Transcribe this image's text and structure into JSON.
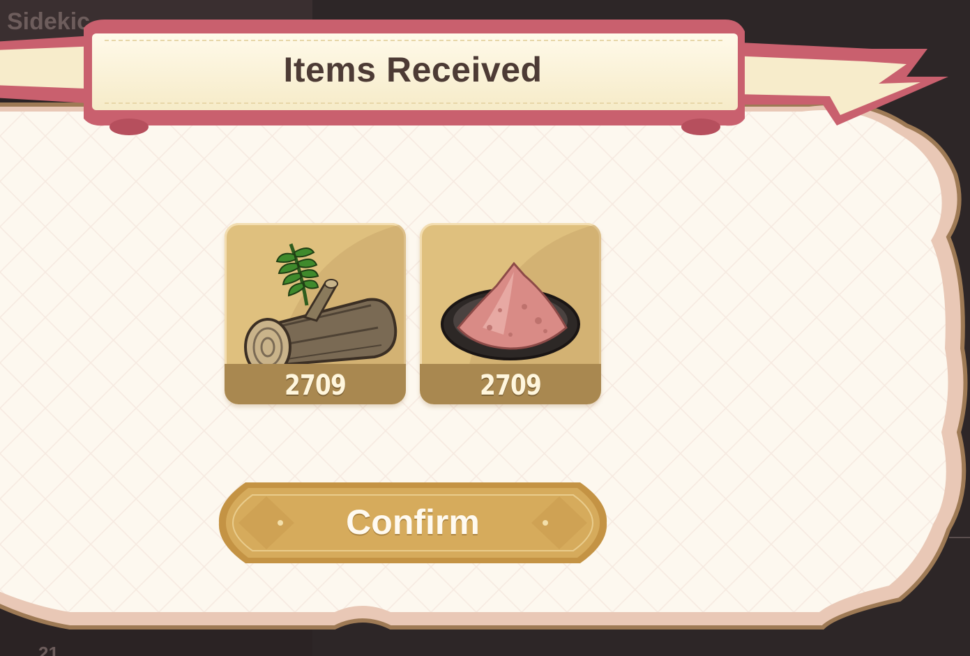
{
  "background": {
    "partial_title": "Sidekic",
    "partial_count": "21"
  },
  "dialog": {
    "title": "Items Received",
    "items": [
      {
        "icon": "wood-log-icon",
        "quantity": "2709"
      },
      {
        "icon": "pink-powder-plate-icon",
        "quantity": "2709"
      }
    ],
    "confirm_label": "Confirm"
  },
  "colors": {
    "ribbon": "#c9606e",
    "banner": "#fbf3d9",
    "panel": "#fdf8ef",
    "panel_border": "#9e7a55",
    "card": "#dfc07e",
    "qty_bar": "#a98850",
    "button": "#d4a85a"
  }
}
